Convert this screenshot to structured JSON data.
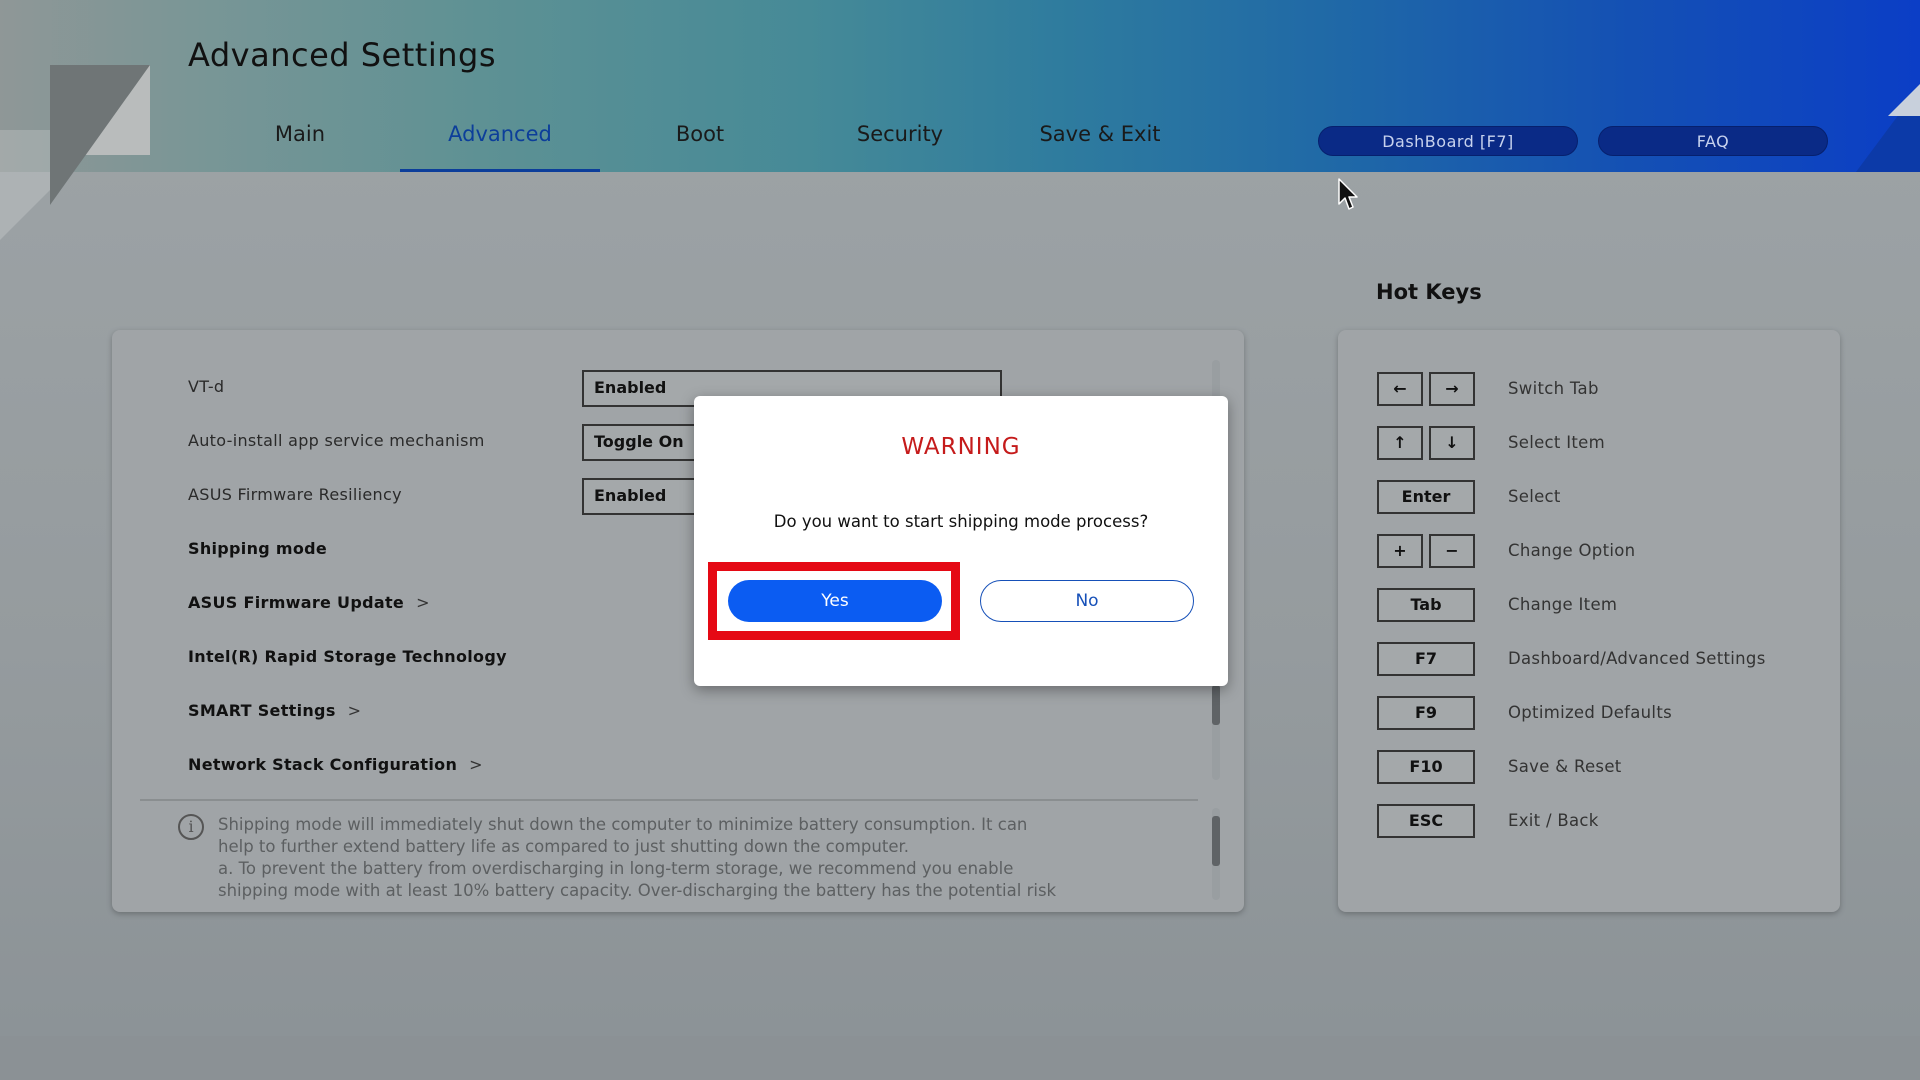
{
  "header": {
    "title": "Advanced Settings",
    "tabs": [
      {
        "label": "Main",
        "active": false
      },
      {
        "label": "Advanced",
        "active": true
      },
      {
        "label": "Boot",
        "active": false
      },
      {
        "label": "Security",
        "active": false
      },
      {
        "label": "Save & Exit",
        "active": false
      }
    ],
    "dashboard_button": "DashBoard [F7]",
    "faq_button": "FAQ"
  },
  "settings": {
    "items": [
      {
        "label": "VT-d",
        "value": "Enabled"
      },
      {
        "label": "Auto-install app service mechanism",
        "value": "Toggle On"
      },
      {
        "label": "ASUS Firmware Resiliency",
        "value": "Enabled"
      },
      {
        "label": "Shipping mode"
      },
      {
        "label": "ASUS Firmware Update",
        "chevron": ">"
      },
      {
        "label": "Intel(R) Rapid Storage Technology"
      },
      {
        "label": "SMART Settings",
        "chevron": ">"
      },
      {
        "label": "Network Stack Configuration",
        "chevron": ">"
      }
    ],
    "help": {
      "icon": "i",
      "lines": [
        "Shipping mode will immediately shut down the computer to minimize battery consumption. It can",
        "help to further extend battery life as compared to just shutting down the computer.",
        "a. To prevent the battery from overdischarging in long-term storage, we recommend you enable",
        "shipping mode with at least 10% battery capacity. Over-discharging the battery has the potential risk"
      ]
    }
  },
  "hotkeys": {
    "title": "Hot Keys",
    "items": [
      {
        "keys": [
          "←",
          "→"
        ],
        "desc": "Switch Tab"
      },
      {
        "keys": [
          "↑",
          "↓"
        ],
        "desc": "Select Item"
      },
      {
        "keys": [
          "Enter"
        ],
        "desc": "Select"
      },
      {
        "keys": [
          "+",
          "−"
        ],
        "desc": "Change Option"
      },
      {
        "keys": [
          "Tab"
        ],
        "desc": "Change Item"
      },
      {
        "keys": [
          "F7"
        ],
        "desc": "Dashboard/Advanced Settings"
      },
      {
        "keys": [
          "F9"
        ],
        "desc": "Optimized Defaults"
      },
      {
        "keys": [
          "F10"
        ],
        "desc": "Save & Reset"
      },
      {
        "keys": [
          "ESC"
        ],
        "desc": "Exit / Back"
      }
    ]
  },
  "dialog": {
    "title": "WARNING",
    "message": "Do you want to start shipping mode process?",
    "yes_label": "Yes",
    "no_label": "No"
  },
  "colors": {
    "warning_red": "#c51b1b",
    "highlight_red": "#e50914",
    "primary_blue": "#0b5cf2",
    "active_tab": "#0c3e9a",
    "pill_bg": "#0a2a86"
  },
  "icons": {
    "cursor": "mouse-pointer-icon",
    "info": "info-icon",
    "chevron": "chevron-right-icon"
  }
}
